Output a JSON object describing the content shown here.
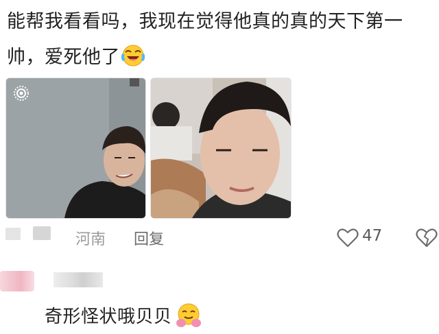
{
  "comment": {
    "text": "能帮我看看吗，我现在觉得他真的真的天下第一帅，爱死他了",
    "emoji": "laughing-crying-face-icon"
  },
  "photos": [
    {
      "name": "photo-1"
    },
    {
      "name": "photo-2"
    }
  ],
  "meta": {
    "location": "河南",
    "reply_label": "回复",
    "like_count": "47"
  },
  "reply": {
    "text": "奇形怪状哦贝贝",
    "emoji": "hugging-face-icon"
  },
  "colors": {
    "text": "#222222",
    "muted": "#9a9a9a",
    "icon": "#6b6b6b"
  }
}
